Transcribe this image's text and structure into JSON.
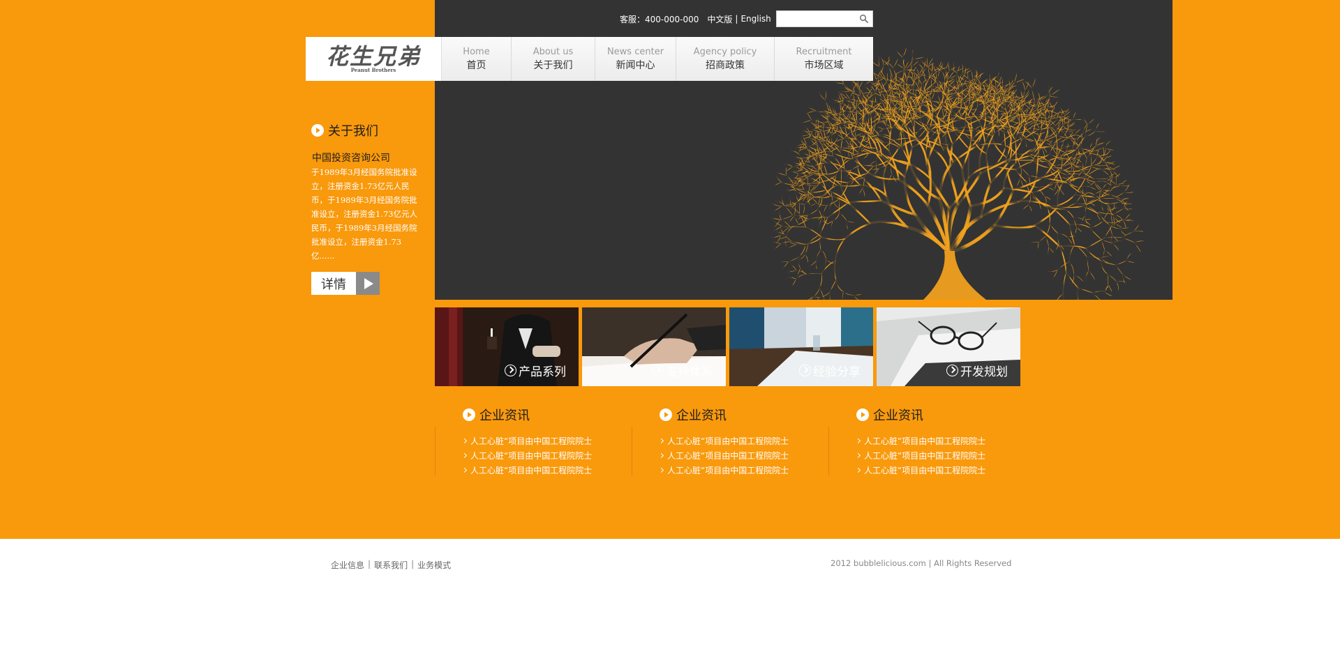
{
  "header": {
    "hotline": "客服：400-000-000",
    "lang_cn": "中文版",
    "lang_sep": "|",
    "lang_en": "English",
    "search_placeholder": ""
  },
  "logo": {
    "main": "花生兄弟",
    "sub": "Peanut Brothers"
  },
  "nav": {
    "items": [
      {
        "en": "Home",
        "cn": "首页"
      },
      {
        "en": "About us",
        "cn": "关于我们"
      },
      {
        "en": "News center",
        "cn": "新闻中心"
      },
      {
        "en": "Agency policy",
        "cn": "招商政策"
      },
      {
        "en": "Recruitment",
        "cn": "市场区域"
      }
    ]
  },
  "about": {
    "title": "关于我们",
    "company": "中国投资咨询公司",
    "body": "于1989年3月经国务院批准设立，注册资金1.73亿元人民币，于1989年3月经国务院批准设立，注册资金1.73亿元人民币，于1989年3月经国务院批准设立，注册资金1.73亿......",
    "details_label": "详情"
  },
  "tiles": [
    {
      "label": "产品系列"
    },
    {
      "label": "支持体系"
    },
    {
      "label": "经验分享"
    },
    {
      "label": "开发规划"
    }
  ],
  "news": [
    {
      "title": "企业资讯",
      "items": [
        "人工心脏“项目由中国工程院院士",
        "人工心脏“项目由中国工程院院士",
        "人工心脏“项目由中国工程院院士"
      ]
    },
    {
      "title": "企业资讯",
      "items": [
        "人工心脏“项目由中国工程院院士",
        "人工心脏“项目由中国工程院院士",
        "人工心脏“项目由中国工程院院士"
      ]
    },
    {
      "title": "企业资讯",
      "items": [
        "人工心脏“项目由中国工程院院士",
        "人工心脏“项目由中国工程院院士",
        "人工心脏“项目由中国工程院院士"
      ]
    }
  ],
  "footer": {
    "links": [
      "企业信息",
      "联系我们",
      "业务模式"
    ],
    "sep": "|",
    "copyright": "2012 bubblelicious.com | All Rights Reserved"
  },
  "colors": {
    "brand_orange": "#f9990c",
    "hero_dark": "#333333",
    "tree_orange": "#f2a21c"
  }
}
